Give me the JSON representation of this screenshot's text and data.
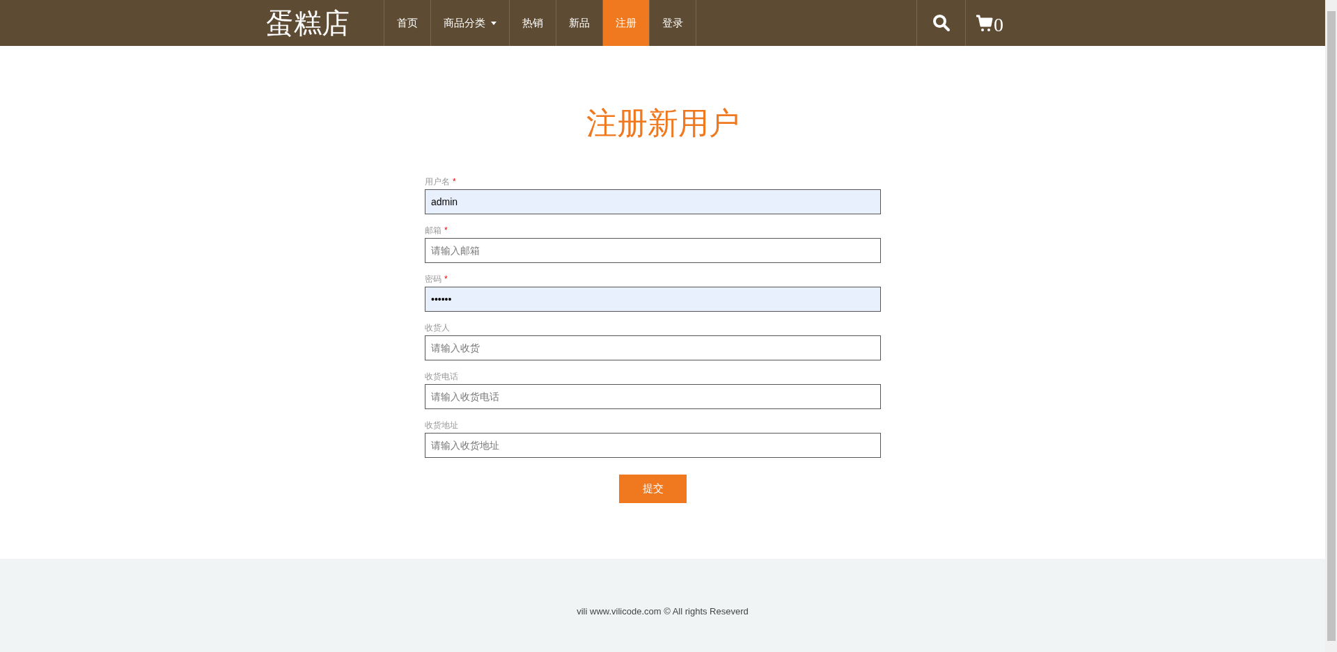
{
  "header": {
    "logo": "蛋糕店",
    "nav": [
      {
        "label": "首页",
        "selected": false,
        "dropdown": false
      },
      {
        "label": "商品分类",
        "selected": false,
        "dropdown": true
      },
      {
        "label": "热销",
        "selected": false,
        "dropdown": false
      },
      {
        "label": "新品",
        "selected": false,
        "dropdown": false
      },
      {
        "label": "注册",
        "selected": true,
        "dropdown": false
      },
      {
        "label": "登录",
        "selected": false,
        "dropdown": false
      }
    ],
    "cart_count": "0"
  },
  "form": {
    "title": "注册新用户",
    "fields": [
      {
        "label": "用户名",
        "required_mark": "*",
        "value": "admin",
        "autofilled": true
      },
      {
        "label": "邮箱",
        "required_mark": "*",
        "placeholder": "请输入邮箱",
        "autofilled": false
      },
      {
        "label": "密码",
        "required_mark": "*",
        "value": "••••••",
        "autofilled": true
      },
      {
        "label": "收货人",
        "placeholder": "请输入收货",
        "autofilled": false
      },
      {
        "label": "收货电话",
        "placeholder": "请输入收货电话",
        "autofilled": false
      },
      {
        "label": "收货地址",
        "placeholder": "请输入收货地址",
        "autofilled": false
      }
    ],
    "submit": "提交"
  },
  "footer": {
    "text": "vili www.vilicode.com © All rights Reseverd"
  }
}
